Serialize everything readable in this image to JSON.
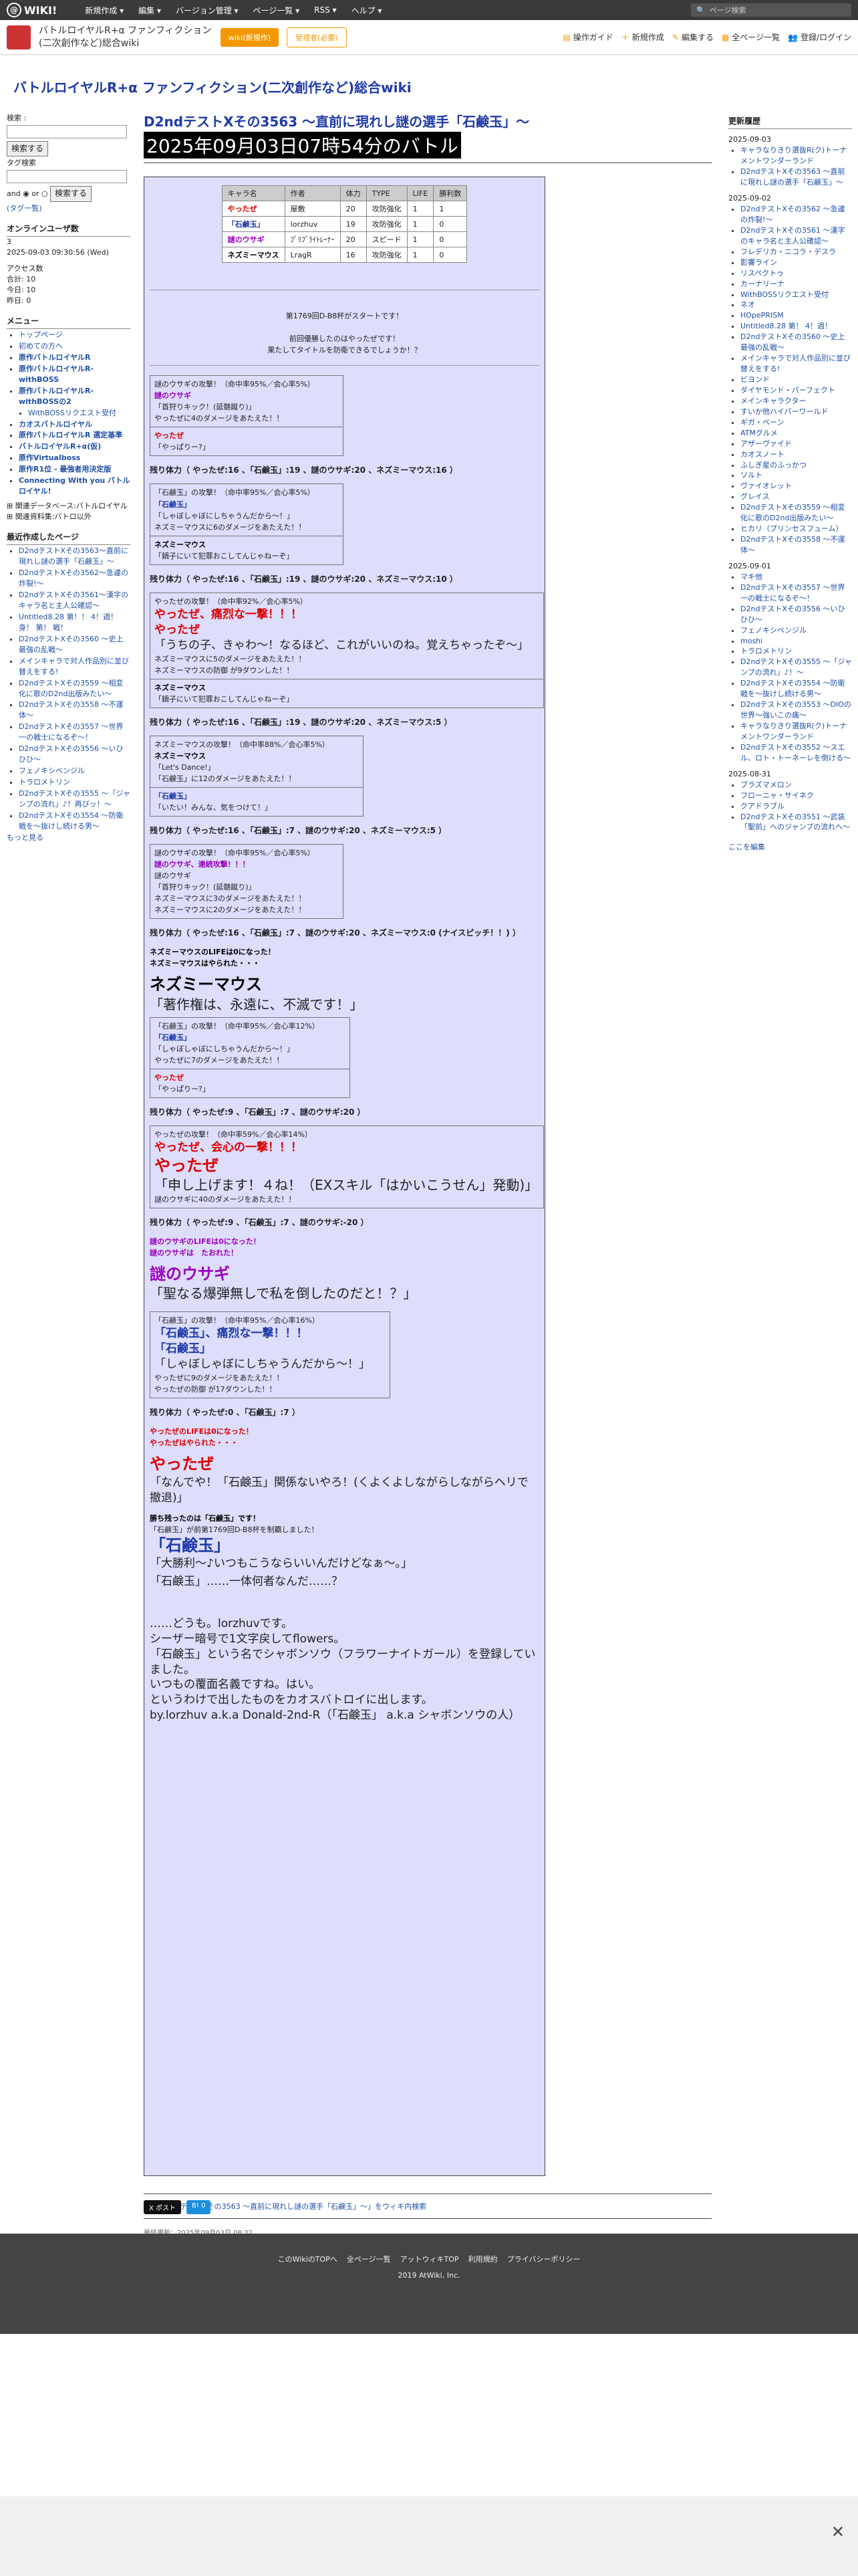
{
  "topbar": {
    "logo": "WIKI!",
    "nav": [
      "新規作成 ▾",
      "編集 ▾",
      "バージョン管理 ▾",
      "ページ一覧 ▾",
      "RSS ▾",
      "ヘルプ ▾"
    ],
    "search_placeholder": "ページ検索"
  },
  "wikibar": {
    "title": "バトルロイヤルR+α ファンフィクション(二次創作など)総合wiki",
    "btn_member": "wiki(新規作)",
    "btn_secondary": "管理者(必要)",
    "actions": [
      "操作ガイド",
      "新規作成",
      "編集する",
      "全ページ一覧",
      "登録/ログイン"
    ]
  },
  "site_title": "バトルロイヤルR+α ファンフィクション(二次創作など)総合wiki",
  "left": {
    "search_label": "検索 :",
    "search_btn": "検索する",
    "tag_label": "タグ検索",
    "radio_label": "and ◉ or ○",
    "search_btn2": "検索する",
    "tag_link": "(タグ一覧)",
    "online_title": "オンラインユーザ数",
    "online_count": "3",
    "online_time": "2025-09-03 09:30:56 (Wed)",
    "access_title": "アクセス数",
    "access": [
      "合計: 10",
      "今日: 10",
      "昨日: 0"
    ],
    "menu_title": "メニュー",
    "menu": [
      "トップページ",
      "初めての方へ",
      "原作バトルロイヤルR",
      "原作バトルロイヤルR-withBOSS",
      "原作バトルロイヤルR-withBOSSの2",
      "WithBOSSリクエスト受付",
      "カオスバトルロイヤル",
      "原作バトルロイヤルR 選定基準",
      "バトルロイヤルR+α(仮)",
      "原作Virtualboss",
      "原作R1位 - 最強者用決定版",
      "Connecting With you バトルロイヤル!"
    ],
    "related": [
      "関連データベース:バトルロイヤル",
      "関連資料集:バトロ以外"
    ],
    "more_title": "最近作成したページ",
    "recent": [
      "D2ndテストXその3563～直前に現れし謎の選手「石鹸玉」～",
      "D2ndテストXその3562～急遽の炸裂!～",
      "D2ndテストXその3561～漢字のキャラ名と主人公確認～",
      "Untitled8.28 第！！ 4！週！ 身！ 第！ 戦！",
      "D2ndテストXその3560 ～史上最強の乱戦～",
      "メインキャラで対人作品別に並び替えをする!",
      "D2ndテストXその3559 ～相変化に歌のD2nd出版みたい～",
      "D2ndテストXその3558 ～不運体～",
      "D2ndテストXその3557 ～世界一の戦士になるぞ～！",
      "D2ndテストXその3556 ～いひひひ～",
      "フェノキシベンジル",
      "トラロメトリン",
      "D2ndテストXその3555 ～「ジャンプの流れ」♪！再びッ！～",
      "D2ndテストXその3554 ～防衛戦を～抜けし続ける男～"
    ],
    "more_link": "もっと見る"
  },
  "main": {
    "title": "D2ndテストXその3563 ～直前に現れし謎の選手「石鹸玉」～",
    "date_title": "2025年09月03日07時54分のバトル",
    "table": {
      "headers": [
        "キャラ名",
        "作者",
        "体力",
        "TYPE",
        "LIFE",
        "勝利数"
      ],
      "rows": [
        [
          "やったぜ",
          "屋敷",
          "20",
          "攻防強化",
          "1",
          "1"
        ],
        [
          "「石鹸玉」",
          "lorzhuv",
          "19",
          "攻防強化",
          "1",
          "0"
        ],
        [
          "謎のウサギ",
          "ﾌﾟﾘﾌﾞﾗｲﾄﾚｰﾅｰ",
          "20",
          "スピード",
          "1",
          "0"
        ],
        [
          "ネズミーマウス",
          "LragR",
          "16",
          "攻防強化",
          "1",
          "0"
        ]
      ]
    },
    "intro1": "第1769回D-B8杯がスタートです！",
    "intro2": "前回優勝したのはやったぜです！",
    "intro3": "果たしてタイトルを防衛できるでしょうか！？",
    "turns": [
      {
        "events": [
          [
            "謎のウサギの攻撃！（命中率95%／会心率5%）",
            "謎のウサギ",
            "「首狩りキック！(延髄蹴り)」",
            "やったぜに4のダメージをあたえた！！"
          ],
          [
            "やったぜ",
            "「やっぱりー?」"
          ]
        ],
        "remain": "残り体力（ やったぜ:16 、「石鹸玉」:19 、謎のウサギ:20 、ネズミーマウス:16 ）"
      },
      {
        "events": [
          [
            "「石鹸玉」の攻撃！（命中率95%／会心率5%）",
            "「石鹸玉」",
            "「しゃぼしゃぼにしちゃうんだから～！」",
            "ネズミーマウスに6のダメージをあたえた！！"
          ],
          [
            "ネズミーマウス",
            "「鍋子にいて犯罪おこしてんじゃねーぞ」"
          ]
        ],
        "remain": "残り体力（ やったぜ:16 、「石鹸玉」:19 、謎のウサギ:20 、ネズミーマウス:10 ）"
      },
      {
        "events": [
          [
            "やったぜの攻撃！（命中率92%／会心率5%）",
            "やったぜ、痛烈な一撃！！！",
            "やったぜ",
            "「うちの子、きゃわ～！なるほど、これがいいのね。覚えちゃったぞ～」",
            "ネズミーマウスに5のダメージをあたえた！！",
            "ネズミーマウスの防御 が9ダウンした！！"
          ],
          [
            "ネズミーマウス",
            "「鍋子にいて犯罪おこしてんじゃねーぞ」"
          ]
        ],
        "remain": "残り体力（ やったぜ:16 、「石鹸玉」:19 、謎のウサギ:20 、ネズミーマウス:5 ）"
      },
      {
        "events": [
          [
            "ネズミーマウスの攻撃！（命中率88%／会心率5%）",
            "ネズミーマウス",
            "「Let's Dance!」",
            "「石鹸玉」に12のダメージをあたえた！！"
          ],
          [
            "「石鹸玉」",
            "「いたい！みんな、気をつけて！」"
          ]
        ],
        "remain": "残り体力（ やったぜ:16 、「石鹸玉」:7 、謎のウサギ:20 、ネズミーマウス:5 ）"
      },
      {
        "events": [
          [
            "謎のウサギの攻撃！（命中率95%／会心率5%）",
            "謎のウサギ、連続攻撃！！！",
            "謎のウサギ",
            "「首狩りキック！(延髄蹴り)」",
            "ネズミーマウスに3のダメージをあたえた！！",
            "ネズミーマウスに2のダメージをあたえた！！"
          ]
        ],
        "remain": "残り体力（ やったぜ:16 、「石鹸玉」:7 、謎のウサギ:20 、ネズミーマウス:0 (ナイスピッチ！！) ）"
      }
    ],
    "ko1_a": "ネズミーマウスのLIFEは0になった！",
    "ko1_b": "ネズミーマウスはやられた・・・",
    "ko1_name": "ネズミーマウス",
    "ko1_line": "「著作権は、永遠に、不滅です！」",
    "turn6": [
      [
        "「石鹸玉」の攻撃！（命中率95%／会心率12%）",
        "「石鹸玉」",
        "「しゃぼしゃぼにしちゃうんだから～！」",
        "やったぜに7のダメージをあたえた！！"
      ],
      [
        "やったぜ",
        "「やっぱりー?」"
      ]
    ],
    "remain6": "残り体力（ やったぜ:9 、「石鹸玉」:7 、謎のウサギ:20 ）",
    "turn7_hd": "やったぜの攻撃！（命中率59%／会心率14%）",
    "turn7_a": "やったぜ、会心の一撃！！！",
    "turn7_name": "やったぜ",
    "turn7_line": "「申し上げます！４ね！（EXスキル「はかいこうせん」発動)」",
    "turn7_dmg": "謎のウサギに40のダメージをあたえた！！",
    "remain7": "残り体力（ やったぜ:9 、「石鹸玉」:7 、謎のウサギ:-20 ）",
    "ko2_a": "謎のウサギのLIFEは0になった！",
    "ko2_b": "謎のウサギは　たおれた！",
    "ko2_name": "謎のウサギ",
    "ko2_line": "「聖なる爆弾無しで私を倒したのだと！？」",
    "turn8_hd": "「石鹸玉」の攻撃！（命中率95%／会心率16%）",
    "turn8_a": "「石鹸玉」、痛烈な一撃！！！",
    "turn8_name": "「石鹸玉」",
    "turn8_line": "「しゃぼしゃぼにしちゃうんだから～！」",
    "turn8_dmg": "やったぜに9のダメージをあたえた！！",
    "turn8_def": "やったぜの防御 が17ダウンした！！",
    "remain8": "残り体力（ やったぜ:0 、「石鹸玉」:7 ）",
    "ko3_a": "やったぜのLIFEは0になった！",
    "ko3_b": "やったぜはやられた・・・",
    "ko3_name": "やったぜ",
    "ko3_line": "「なんでや！「石鹸玉」関係ないやろ！(くよくよしながらしながらヘリで撤退)」",
    "win_a": "勝ち残ったのは「石鹸玉」です！",
    "win_b": "「石鹸玉」が前第1769回D-B8杯を制覇しました！",
    "win_name": "「石鹸玉」",
    "win_line": "「大勝利～♪いつもこうならいいんだけどなぁ～。」",
    "win_after": "「石鹸玉」……一体何者なんだ……？",
    "closing": [
      "……どうも。lorzhuvです。",
      "シーザー暗号で1文字戻してflowers。",
      "「石鹸玉」という名でシャボンソウ（フラワーナイトガール）を登録していました。",
      "いつもの覆面名義ですね。はい。",
      "というわけで出したものをカオスバトロイに出します。",
      "by.lorzhuv a.k.a Donald-2nd-R（「石鹸玉」 a.k.a シャボンソウの人）"
    ],
    "search_link": "🔍「D2ndテストXその3563 ～直前に現れし謎の選手「石鹸玉」～」をウィキ内検索",
    "updated": "最終更新：2025年09月03日 08:32",
    "share": [
      "X ポスト",
      "B! 0"
    ]
  },
  "right": {
    "title": "更新履歴",
    "groups": [
      {
        "date": "2025-09-03",
        "items": [
          "キャラなりきり選抜R(ク)トーナメントワンダーランド",
          "D2ndテストXその3563 ～直前に現れし謎の選手「石鹸玉」～"
        ]
      },
      {
        "date": "2025-09-02",
        "items": [
          "D2ndテストXその3562 ～急遽の炸裂!～",
          "D2ndテストXその3561 ～漢字のキャラ名と主人公確認～",
          "フレデリカ・ニコラ・デスラ",
          "影響ライン",
          "リスペクトゥ",
          "カーナリーナ",
          "WithBOSSリクエスト受付",
          "ネオ",
          "HOpePRISM",
          "Untitled8.28 第！ 4！週！",
          "D2ndテストXその3560 ～史上最強の乱戦～",
          "メインキャラで対人作品別に並び替えをする!",
          "ビヨンド",
          "ダイヤモンド・パーフェクト",
          "メインキャラクター",
          "すいか他ハイパーワールド",
          "ギガ・ベーン",
          "ATMグルメ",
          "アザーヴァイド",
          "カオスノート",
          "ふしぎ星のふっかつ",
          "ソルト",
          "ヴァイオレット",
          "グレイス",
          "D2ndテストXその3559 ～相変化に歌のD2nd出版みたい～",
          "ヒカリ（プリンセスフューム）",
          "D2ndテストXその3558 ～不運体～"
        ]
      },
      {
        "date": "2025-09-01",
        "items": [
          "マキ他",
          "D2ndテストXその3557 ～世界一の戦士になるぞ～！",
          "D2ndテストXその3556 ～いひひひ～",
          "フェノキシベンジル",
          "moshi",
          "トラロメトリン",
          "D2ndテストXその3555 ～「ジャンプの流れ」♪！～",
          "D2ndテストXその3554 ～防衛戦を～抜けし続ける男～",
          "D2ndテストXその3553 ～DIOの世界～強いこの痛～",
          "キャラなりきり選抜R(ク)トーナメントワンダーランド",
          "D2ndテストXその3552 ～スエル、ロト・トーネーレを倒ける～"
        ]
      },
      {
        "date": "2025-08-31",
        "items": [
          "プラズマメロン",
          "フローニャ・サイネク",
          "クアドラブル",
          "D2ndテストXその3551 ～武装「聖前」へのジャンプの流れへ～"
        ]
      }
    ],
    "more": "ここを編集"
  },
  "footer": {
    "links": [
      "このWikiのTOPへ",
      "全ページ一覧",
      "アットウィキTOP",
      "利用規約",
      "プライバシーポリシー"
    ],
    "copy": "2019 AtWiki, Inc."
  },
  "colors": {
    "accent": "#f39800",
    "title_blue": "#1f3aa8",
    "battle_bg": "#ddddfc",
    "red": "#d00",
    "purple": "#9a00c0"
  }
}
